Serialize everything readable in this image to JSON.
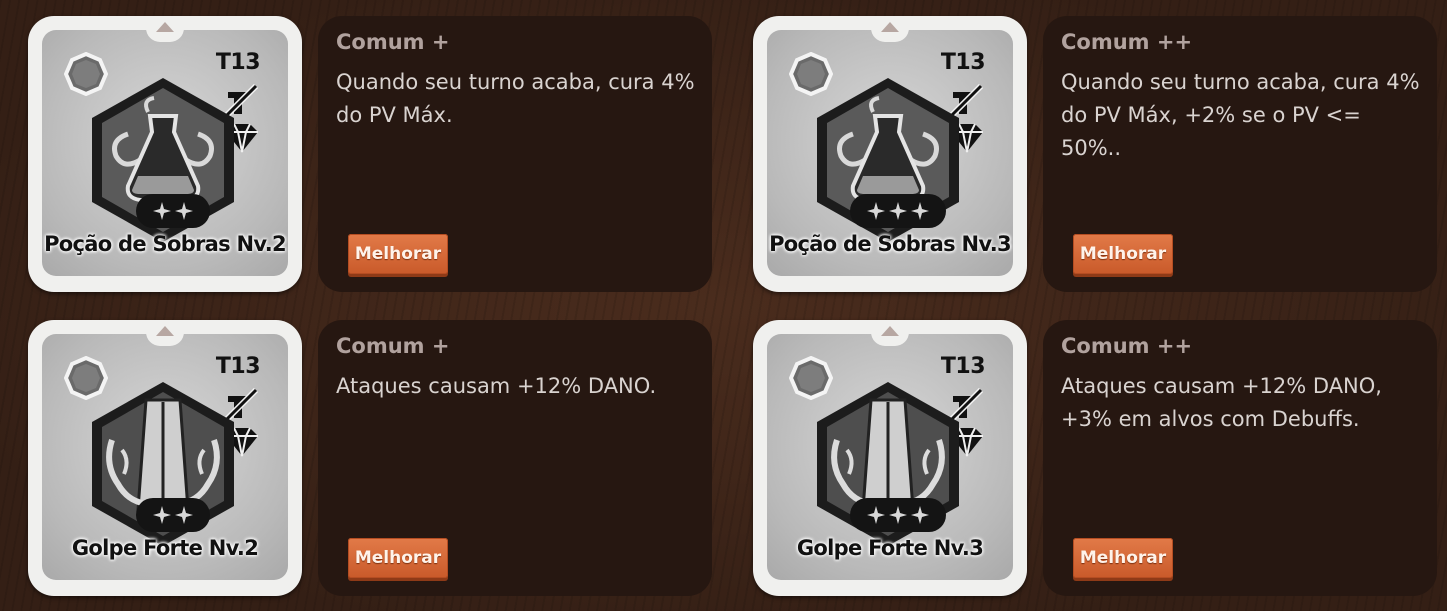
{
  "upgrade_label": "Melhorar",
  "cards": [
    {
      "tier": "T13",
      "name": "Poção de Sobras Nv.2",
      "rarity": "Comum +",
      "description": "Quando seu turno acaba, cura 4% do PV Máx.",
      "stars": 2,
      "icon": "potion-emblem-icon"
    },
    {
      "tier": "T13",
      "name": "Poção de Sobras Nv.3",
      "rarity": "Comum ++",
      "description": "Quando seu turno acaba, cura 4% do PV Máx, +2% se o PV <= 50%..",
      "stars": 3,
      "icon": "potion-emblem-icon"
    },
    {
      "tier": "T13",
      "name": "Golpe Forte Nv.2",
      "rarity": "Comum +",
      "description": "Ataques causam +12% DANO.",
      "stars": 2,
      "icon": "heavy-blow-emblem-icon"
    },
    {
      "tier": "T13",
      "name": "Golpe Forte Nv.3",
      "rarity": "Comum ++",
      "description": "Ataques causam +12% DANO, +3% em alvos com Debuffs.",
      "stars": 3,
      "icon": "heavy-blow-emblem-icon"
    }
  ],
  "colors": {
    "background": "#3b2418",
    "panel": "#261711",
    "rarity_text": "#b1a29e",
    "button": "#d96a38"
  }
}
